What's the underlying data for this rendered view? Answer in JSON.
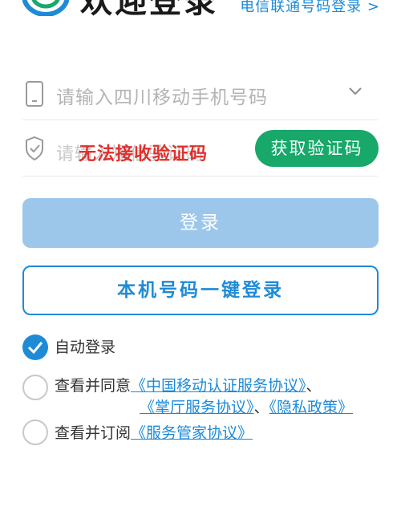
{
  "header": {
    "title": "欢迎登录",
    "alt_login_link": "电信联通号码登录 >"
  },
  "form": {
    "phone_placeholder": "请输入四川移动手机号码",
    "code_placeholder": "请输入短信验证码",
    "watermark_text": "无法接收验证码",
    "get_code_button": "获取验证码"
  },
  "actions": {
    "login_button": "登录",
    "one_key_login_button": "本机号码一键登录"
  },
  "options": {
    "auto_login": {
      "label": "自动登录",
      "checked": true
    },
    "agree": {
      "prefix": "查看并同意",
      "link1": "《中国移动认证服务协议》",
      "sep1": "、",
      "link2": "《掌厅服务协议》",
      "sep2": "、",
      "link3": "《隐私政策》",
      "checked": false
    },
    "subscribe": {
      "prefix": "查看并订阅",
      "link": "《服务管家协议》",
      "checked": false
    }
  },
  "colors": {
    "accent_blue": "#1e8bd7",
    "green": "#17a86a",
    "disabled_blue": "#9cc7ea",
    "watermark_red": "#e0302c"
  },
  "icons": [
    "app-logo-icon",
    "phone-icon",
    "chevron-down-icon",
    "shield-check-icon",
    "checkmark-icon"
  ]
}
